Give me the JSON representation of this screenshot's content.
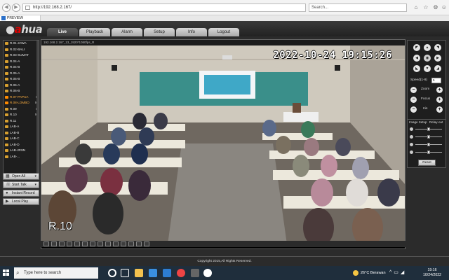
{
  "browser": {
    "url": "http://192.168.2.167/",
    "search_placeholder": "Search...",
    "tab_title": "PREVIEW"
  },
  "app": {
    "logo": "alhua",
    "menu": [
      "Live",
      "Playback",
      "Alarm",
      "Setup",
      "Info",
      "Logout"
    ],
    "active_menu": "Live"
  },
  "channels": [
    {
      "label": "R.01-JAWA",
      "suffix": "",
      "alert": false
    },
    {
      "label": "R.02-BALI",
      "suffix": "",
      "alert": false
    },
    {
      "label": "R.03-SUMAT",
      "suffix": "",
      "alert": false
    },
    {
      "label": "R.04-A",
      "suffix": "",
      "alert": false
    },
    {
      "label": "R.04-B",
      "suffix": "",
      "alert": false
    },
    {
      "label": "R.05-A",
      "suffix": "",
      "alert": false
    },
    {
      "label": "R.05-B",
      "suffix": "",
      "alert": false
    },
    {
      "label": "R.06-A",
      "suffix": "",
      "alert": false
    },
    {
      "label": "R.06-B",
      "suffix": "",
      "alert": false
    },
    {
      "label": "R.07-PAPUA",
      "suffix": "S",
      "alert": true
    },
    {
      "label": "R.08-LOMBO",
      "suffix": "M",
      "alert": true
    },
    {
      "label": "R.09",
      "suffix": "S",
      "alert": false
    },
    {
      "label": "R.10",
      "suffix": "M",
      "alert": false
    },
    {
      "label": "R.11",
      "suffix": "",
      "alert": false
    },
    {
      "label": "LAB-A",
      "suffix": "",
      "alert": false
    },
    {
      "label": "LAB-B",
      "suffix": "",
      "alert": false
    },
    {
      "label": "LAB-C",
      "suffix": "",
      "alert": false
    },
    {
      "label": "LAB-D",
      "suffix": "",
      "alert": false
    },
    {
      "label": "LAB-JRSN",
      "suffix": "",
      "alert": false
    },
    {
      "label": "LAB-...",
      "suffix": "",
      "alert": false
    }
  ],
  "side_buttons": [
    {
      "label": "Open All",
      "icon": "grid-icon",
      "arrow": "▾"
    },
    {
      "label": "Start Talk",
      "icon": "phone-icon",
      "arrow": "▾"
    },
    {
      "label": "Instant Record",
      "icon": "record-icon",
      "arrow": ""
    },
    {
      "label": "Local Play",
      "icon": "play-icon",
      "arrow": ""
    }
  ],
  "video": {
    "title": "192.168.2.167_13_1920*1080fps_R",
    "timestamp": "2022-10-24 19:15:26",
    "room": "R.10"
  },
  "ptz": {
    "speed_label": "Speed(1-8)",
    "speed_value": "5",
    "zoom_label": "Zoom",
    "focus_label": "Focus",
    "iris_label": "Iris"
  },
  "image_setup": {
    "tabs": [
      "Image Setup",
      "Relay-out"
    ],
    "reset_label": "Reset",
    "slider_levels": [
      0.5,
      0.5,
      0.5,
      0.5
    ]
  },
  "footer": "Copyright 2015,All Rights Reserved.",
  "taskbar": {
    "search_placeholder": "Type here to search",
    "weather_temp": "26°C",
    "weather_desc": "Berawan",
    "time": "19:16",
    "date": "10/24/2022"
  }
}
